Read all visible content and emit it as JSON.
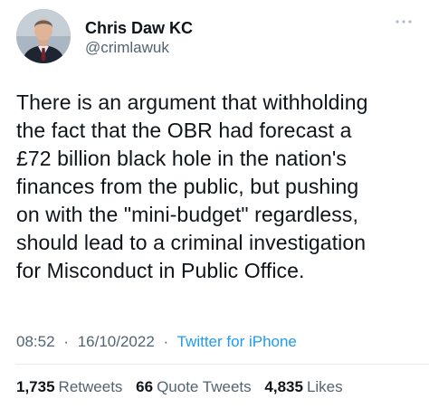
{
  "author": {
    "display_name": "Chris Daw KC",
    "handle": "@crimlawuk",
    "avatar_icon": "person-portrait-icon"
  },
  "more_icon": "ellipsis-icon",
  "tweet": {
    "text": "There is an argument that withholding\nthe fact that the OBR had forecast a\n£72 billion black hole in the nation's\nfinances from the public, but pushing\non with the \"mini-budget\" regardless,\nshould lead to a criminal investigation\nfor Misconduct in Public Office.",
    "time": "08:52",
    "date": "16/10/2022",
    "separator": "·",
    "source": "Twitter for iPhone"
  },
  "stats": {
    "retweets_count": "1,735",
    "retweets_label": "Retweets",
    "quotes_count": "66",
    "quotes_label": "Quote Tweets",
    "likes_count": "4,835",
    "likes_label": "Likes"
  },
  "colors": {
    "text": "#0f1419",
    "secondary": "#536471",
    "link": "#1d9bf0",
    "divider": "#e6ecf0"
  }
}
